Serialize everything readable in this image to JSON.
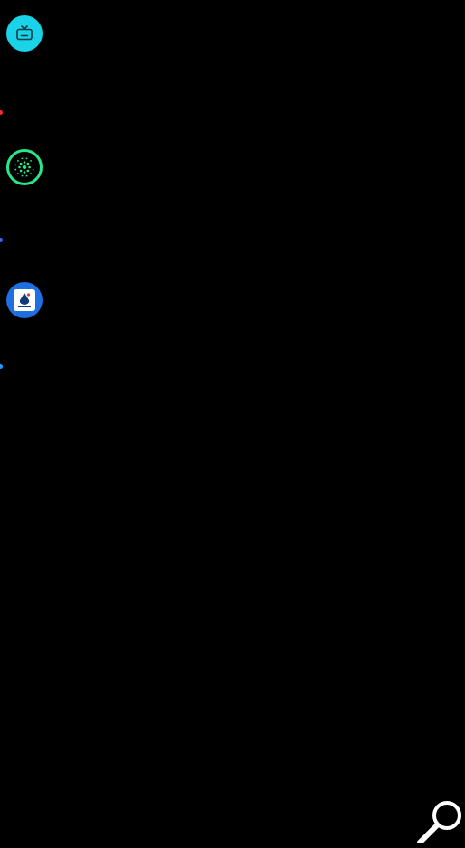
{
  "screen": {
    "background": "#000000"
  },
  "sidebar": {
    "apps": [
      {
        "icon": "tv-icon",
        "color": "#1ad3e8"
      },
      {
        "icon": "dots-grid-icon",
        "color": "#27e887"
      },
      {
        "icon": "brand-logo-icon",
        "color": "#1f6fe0"
      }
    ],
    "indicators": [
      {
        "color": "#ff2a2a"
      },
      {
        "color": "#2a6cff"
      },
      {
        "color": "#1a9bff"
      }
    ]
  },
  "search": {
    "icon": "search-icon",
    "color": "#ffffff"
  }
}
